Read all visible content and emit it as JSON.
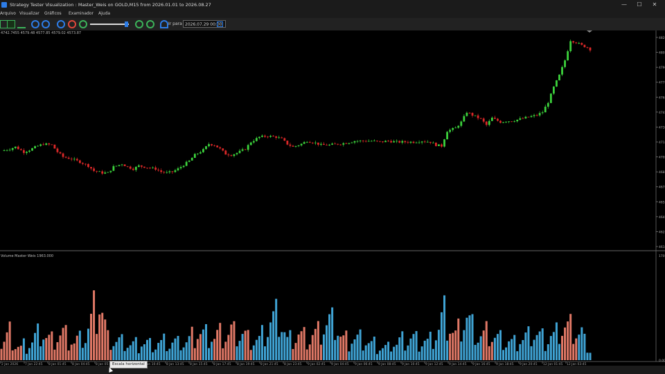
{
  "window": {
    "title": "Strategy Tester Visualization : Master_Weis on GOLD,M15 from 2026.01.01 to 2026.08.27",
    "minimize": "—",
    "maximize": "☐",
    "close": "✕"
  },
  "menu": [
    "Arquivo",
    "Visualizar",
    "Gráficos",
    "Examinador",
    "Ajuda"
  ],
  "toolbar": {
    "goto_label": "Ir para",
    "goto_value": "2026.07.29 00:00",
    "icons": [
      "bar-chart-icon",
      "candle-chart-icon",
      "line-chart-icon",
      "zoom-in-icon",
      "zoom-out-icon",
      "step-back-icon",
      "pause-icon",
      "play-icon",
      "speed-slider",
      "skip-icon",
      "stop-icon",
      "goto-icon",
      "calendar-icon"
    ],
    "colors": {
      "blue": "#2d7de8",
      "red": "#e0473a",
      "green": "#3cb45a"
    }
  },
  "price_panel": {
    "info": "4742.7455  4579.48  4577.85  4579.02  4573.87",
    "y_ticks": [
      "4820",
      "4805",
      "4790",
      "4775",
      "4760",
      "4745",
      "4730",
      "4715",
      "4700",
      "4685",
      "4670",
      "4655",
      "4640",
      "4625",
      "4610"
    ]
  },
  "volume_panel": {
    "label": "Volume Master Weis 1963.000",
    "y_ticks": [
      "1700",
      "0.00"
    ]
  },
  "time_axis": [
    "2 Jan 2026",
    "7 Jan 22:45",
    "8 Jan 01:45",
    "8 Jan 04:45",
    "8 Jan 05:45",
    "8 Jan 09:45",
    "8 Jan 10:45",
    "8 Jan 13:45",
    "8 Jan 15:45",
    "8 Jan 17:45",
    "8 Jan 19:45",
    "8 Jan 21:45",
    "8 Jan 23:45",
    "9 Jan 02:45",
    "9 Jan 04:45",
    "9 Jan 06:45",
    "9 Jan 08:45",
    "9 Jan 10:45",
    "9 Jan 12:45",
    "9 Jan 14:45",
    "9 Jan 16:45",
    "9 Jan 18:45",
    "9 Jan 20:45",
    "12 Jan 01:45",
    "12 Jan 03:45"
  ],
  "tooltip": "Escala horizontal",
  "chart_data": {
    "type": "candlestick",
    "up_color": "#3cd23c",
    "down_color": "#dc2828",
    "vol_up_color": "#3fa3d4",
    "vol_down_color": "#e07866",
    "close_path": [
      [
        0,
        4706
      ],
      [
        3,
        4708
      ],
      [
        5,
        4710
      ],
      [
        8,
        4705
      ],
      [
        10,
        4707
      ],
      [
        13,
        4711
      ],
      [
        15,
        4713
      ],
      [
        18,
        4712
      ],
      [
        20,
        4705
      ],
      [
        22,
        4700
      ],
      [
        25,
        4698
      ],
      [
        28,
        4695
      ],
      [
        31,
        4691
      ],
      [
        33,
        4686
      ],
      [
        36,
        4684
      ],
      [
        38,
        4684
      ],
      [
        40,
        4690
      ],
      [
        43,
        4693
      ],
      [
        45,
        4690
      ],
      [
        47,
        4688
      ],
      [
        49,
        4691
      ],
      [
        51,
        4690
      ],
      [
        53,
        4689
      ],
      [
        55,
        4688
      ],
      [
        57,
        4685
      ],
      [
        59,
        4684
      ],
      [
        61,
        4685
      ],
      [
        63,
        4688
      ],
      [
        65,
        4692
      ],
      [
        67,
        4696
      ],
      [
        69,
        4702
      ],
      [
        72,
        4707
      ],
      [
        74,
        4713
      ],
      [
        76,
        4712
      ],
      [
        78,
        4708
      ],
      [
        80,
        4703
      ],
      [
        82,
        4702
      ],
      [
        84,
        4704
      ],
      [
        87,
        4708
      ],
      [
        89,
        4715
      ],
      [
        92,
        4720
      ],
      [
        95,
        4721
      ],
      [
        98,
        4720
      ],
      [
        100,
        4718
      ],
      [
        102,
        4713
      ],
      [
        104,
        4710
      ],
      [
        107,
        4713
      ],
      [
        109,
        4716
      ],
      [
        112,
        4714
      ],
      [
        114,
        4712
      ],
      [
        117,
        4712
      ],
      [
        120,
        4713
      ],
      [
        123,
        4714
      ],
      [
        126,
        4716
      ],
      [
        129,
        4716
      ],
      [
        132,
        4716
      ],
      [
        135,
        4715
      ],
      [
        138,
        4716
      ],
      [
        141,
        4715
      ],
      [
        144,
        4715
      ],
      [
        147,
        4715
      ],
      [
        150,
        4716
      ],
      [
        153,
        4715
      ],
      [
        155,
        4712
      ],
      [
        157,
        4711
      ],
      [
        159,
        4726
      ],
      [
        162,
        4729
      ],
      [
        164,
        4735
      ],
      [
        166,
        4745
      ],
      [
        168,
        4742
      ],
      [
        171,
        4738
      ],
      [
        173,
        4732
      ],
      [
        175,
        4739
      ],
      [
        178,
        4735
      ],
      [
        180,
        4736
      ],
      [
        182,
        4736
      ],
      [
        185,
        4738
      ],
      [
        188,
        4740
      ],
      [
        191,
        4742
      ],
      [
        193,
        4745
      ],
      [
        195,
        4755
      ],
      [
        197,
        4770
      ],
      [
        199,
        4782
      ],
      [
        201,
        4797
      ],
      [
        203,
        4817
      ],
      [
        205,
        4815
      ],
      [
        207,
        4812
      ],
      [
        209,
        4810
      ],
      [
        210,
        4808
      ]
    ],
    "volume": [
      [
        0,
        400,
        "down"
      ],
      [
        3,
        650,
        "down"
      ],
      [
        6,
        300,
        "down"
      ],
      [
        10,
        420,
        "up"
      ],
      [
        14,
        700,
        "up"
      ],
      [
        18,
        500,
        "down"
      ],
      [
        22,
        650,
        "down"
      ],
      [
        26,
        450,
        "down"
      ],
      [
        30,
        560,
        "up"
      ],
      [
        33,
        1200,
        "down"
      ],
      [
        35,
        1570,
        "down"
      ],
      [
        38,
        500,
        "down"
      ],
      [
        42,
        500,
        "up"
      ],
      [
        46,
        360,
        "up"
      ],
      [
        50,
        420,
        "up"
      ],
      [
        54,
        380,
        "up"
      ],
      [
        58,
        450,
        "up"
      ],
      [
        62,
        420,
        "up"
      ],
      [
        66,
        450,
        "up"
      ],
      [
        70,
        720,
        "down"
      ],
      [
        74,
        560,
        "up"
      ],
      [
        78,
        620,
        "down"
      ],
      [
        82,
        720,
        "down"
      ],
      [
        85,
        680,
        "up"
      ],
      [
        88,
        550,
        "down"
      ],
      [
        92,
        500,
        "up"
      ],
      [
        96,
        950,
        "up"
      ],
      [
        99,
        1150,
        "up"
      ],
      [
        102,
        500,
        "up"
      ],
      [
        106,
        650,
        "down"
      ],
      [
        110,
        560,
        "down"
      ],
      [
        113,
        700,
        "down"
      ],
      [
        116,
        920,
        "up"
      ],
      [
        119,
        920,
        "up"
      ],
      [
        122,
        500,
        "down"
      ],
      [
        126,
        520,
        "up"
      ],
      [
        130,
        500,
        "up"
      ],
      [
        134,
        350,
        "up"
      ],
      [
        138,
        320,
        "up"
      ],
      [
        142,
        480,
        "up"
      ],
      [
        146,
        560,
        "up"
      ],
      [
        150,
        450,
        "up"
      ],
      [
        154,
        500,
        "up"
      ],
      [
        158,
        1150,
        "up"
      ],
      [
        162,
        600,
        "down"
      ],
      [
        166,
        1100,
        "up"
      ],
      [
        170,
        550,
        "up"
      ],
      [
        174,
        700,
        "down"
      ],
      [
        178,
        500,
        "up"
      ],
      [
        182,
        450,
        "up"
      ],
      [
        186,
        520,
        "up"
      ],
      [
        190,
        650,
        "up"
      ],
      [
        194,
        500,
        "up"
      ],
      [
        198,
        660,
        "up"
      ],
      [
        201,
        880,
        "down"
      ],
      [
        204,
        760,
        "down"
      ],
      [
        207,
        650,
        "up"
      ],
      [
        209,
        300,
        "up"
      ]
    ],
    "price_ylim": [
      4610,
      4820
    ],
    "volume_ylim": [
      0,
      1700
    ],
    "grid": false
  }
}
